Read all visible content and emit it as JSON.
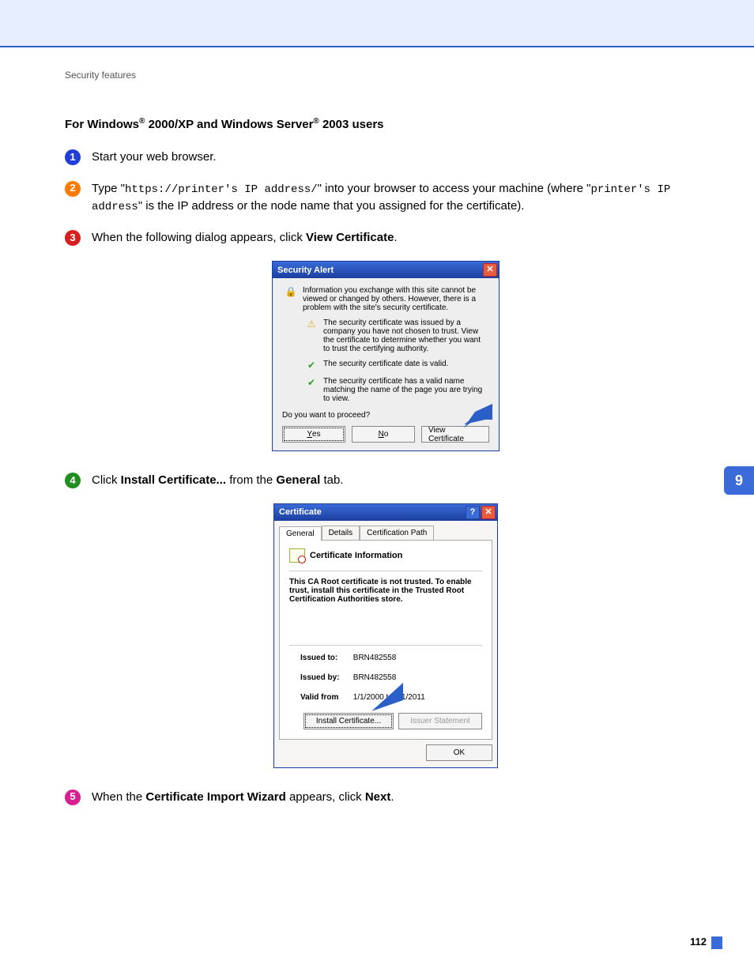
{
  "breadcrumb": "Security features",
  "heading_parts": {
    "p1": "For Windows",
    "reg1": "®",
    "p2": " 2000/XP and Windows Server",
    "reg2": "®",
    "p3": " 2003 users"
  },
  "steps": {
    "s1": {
      "num": "1",
      "text": "Start your web browser."
    },
    "s2": {
      "num": "2",
      "t1": "Type \"",
      "code1": "https://printer's IP address/",
      "t2": "\" into your browser to access your machine (where \"",
      "code2": "printer's IP address",
      "t3": "\" is the IP address or the node name that you assigned for the certificate)."
    },
    "s3": {
      "num": "3",
      "t1": "When the following dialog appears, click ",
      "bold": "View Certificate",
      "t2": "."
    },
    "s4": {
      "num": "4",
      "t1": "Click ",
      "bold1": "Install Certificate...",
      "t2": " from the ",
      "bold2": "General",
      "t3": " tab."
    },
    "s5": {
      "num": "5",
      "t1": "When the ",
      "bold1": "Certificate Import Wizard",
      "t2": " appears, click ",
      "bold2": "Next",
      "t3": "."
    }
  },
  "security_alert": {
    "title": "Security Alert",
    "line1": "Information you exchange with this site cannot be viewed or changed by others. However, there is a problem with the site's security certificate.",
    "warn": "The security certificate was issued by a company you have not chosen to trust. View the certificate to determine whether you want to trust the certifying authority.",
    "ok1": "The security certificate date is valid.",
    "ok2": "The security certificate has a valid name matching the name of the page you are trying to view.",
    "proceed": "Do you want to proceed?",
    "btn_yes": "Yes",
    "btn_no": "No",
    "btn_view": "View Certificate"
  },
  "certificate": {
    "title": "Certificate",
    "tabs": {
      "general": "General",
      "details": "Details",
      "cpath": "Certification Path"
    },
    "info_header": "Certificate Information",
    "trust_msg": "This CA Root certificate is not trusted. To enable trust, install this certificate in the Trusted Root Certification Authorities store.",
    "issued_to_label": "Issued to:",
    "issued_to_val": "BRN482558",
    "issued_by_label": "Issued by:",
    "issued_by_val": "BRN482558",
    "valid_label": "Valid from",
    "valid_val": " 1/1/2000  to  8/1/2011",
    "btn_install": "Install Certificate...",
    "btn_issuer": "Issuer Statement",
    "btn_ok": "OK"
  },
  "side_tab": "9",
  "page_number": "112"
}
